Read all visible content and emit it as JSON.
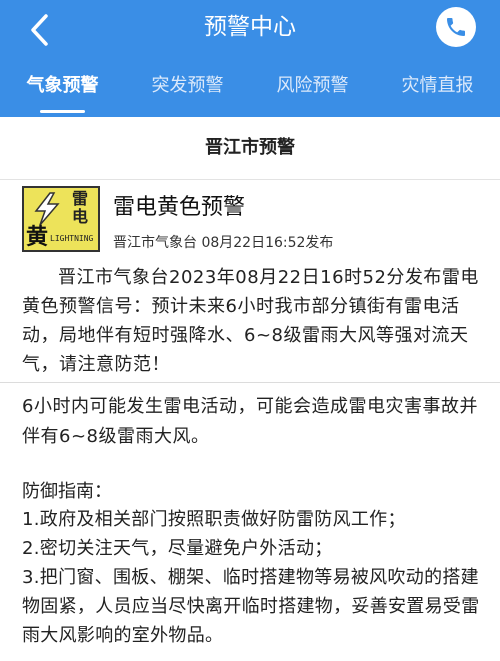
{
  "header": {
    "title": "预警中心",
    "back_icon": "chevron-left-icon",
    "phone_icon": "phone-icon",
    "color": "#3a8ee6"
  },
  "tabs": [
    {
      "label": "气象预警",
      "active": true
    },
    {
      "label": "突发预警",
      "active": false
    },
    {
      "label": "风险预警",
      "active": false
    },
    {
      "label": "灾情直报",
      "active": false
    }
  ],
  "section": {
    "title": "晋江市预警"
  },
  "alert": {
    "icon": {
      "char_top": "雷",
      "char_mid": "电",
      "char_big": "黄",
      "text": "LIGHTNING",
      "color": "#ede35a"
    },
    "name": "雷电黄色预警",
    "source": "晋江市气象台 08月22日16:52发布",
    "body": "晋江市气象台2023年08月22日16时52分发布雷电黄色预警信号：预计未来6小时我市部分镇街有雷电活动，局地伴有短时强降水、6~8级雷雨大风等强对流天气，请注意防范！"
  },
  "impact": "6小时内可能发生雷电活动，可能会造成雷电灾害事故并伴有6~8级雷雨大风。",
  "guide": {
    "heading": "防御指南：",
    "items": [
      "1.政府及相关部门按照职责做好防雷防风工作；",
      "2.密切关注天气，尽量避免户外活动；",
      "3.把门窗、围板、棚架、临时搭建物等易被风吹动的搭建物固紧，人员应当尽快离开临时搭建物，妥善安置易受雷雨大风影响的室外物品。"
    ]
  }
}
